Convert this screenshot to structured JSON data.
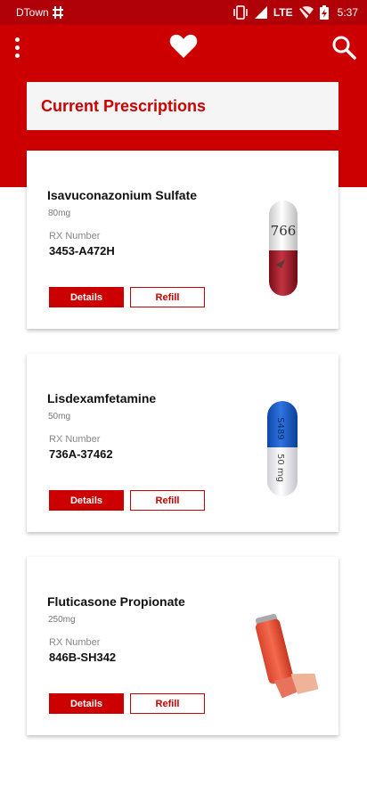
{
  "status_bar": {
    "carrier": "DTown",
    "network": "LTE",
    "time": "5:37",
    "icons": [
      "network-hash-icon",
      "vibrate-icon",
      "signal-icon",
      "wifi-off-icon",
      "battery-charging-icon"
    ]
  },
  "app_bar": {
    "menu_icon": "more-vert-icon",
    "logo_icon": "heart-icon",
    "search_icon": "search-icon",
    "colors": {
      "primary": "#cc0000",
      "status": "#b00008"
    }
  },
  "page": {
    "title": "Current Prescriptions"
  },
  "prescriptions": [
    {
      "name": "Isavuconazonium Sulfate",
      "dose": "80mg",
      "rx_label": "RX Number",
      "rx_number": "3453-A472H",
      "details_label": "Details",
      "refill_label": "Refill",
      "image": "capsule-white-red",
      "imprint": "766"
    },
    {
      "name": "Lisdexamfetamine",
      "dose": "50mg",
      "rx_label": "RX Number",
      "rx_number": "736A-37462",
      "details_label": "Details",
      "refill_label": "Refill",
      "image": "capsule-blue-white",
      "imprint_top": "S489",
      "imprint_bottom": "50 mg"
    },
    {
      "name": "Fluticasone Propionate",
      "dose": "250mg",
      "rx_label": "RX Number",
      "rx_number": "846B-SH342",
      "details_label": "Details",
      "refill_label": "Refill",
      "image": "inhaler-orange"
    }
  ]
}
